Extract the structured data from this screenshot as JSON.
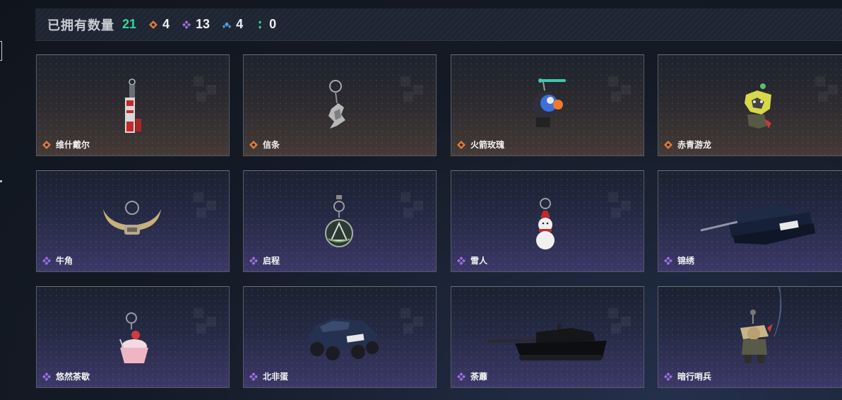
{
  "header": {
    "title": "已拥有数量",
    "total": "21",
    "stats": [
      {
        "icon": "orange-gem-icon",
        "value": "4",
        "color": "#e07a3a"
      },
      {
        "icon": "purple-gem-icon",
        "value": "13",
        "color": "#a06ee0"
      },
      {
        "icon": "blue-gem-icon",
        "value": "4",
        "color": "#4f9fe8"
      },
      {
        "icon": "green-gem-icon",
        "value": "0",
        "color": "#35d49a"
      }
    ]
  },
  "items": [
    {
      "name": "维什戴尔",
      "rarity": "orange",
      "icon": "banner-charm-icon"
    },
    {
      "name": "信条",
      "rarity": "orange",
      "icon": "eagle-charm-icon"
    },
    {
      "name": "火箭玫瑰",
      "rarity": "orange",
      "icon": "rocket-charm-icon"
    },
    {
      "name": "赤青游龙",
      "rarity": "orange",
      "icon": "dragon-charm-icon"
    },
    {
      "name": "牛角",
      "rarity": "purple",
      "icon": "horn-charm-icon"
    },
    {
      "name": "启程",
      "rarity": "purple",
      "icon": "medal-charm-icon"
    },
    {
      "name": "雪人",
      "rarity": "purple",
      "icon": "snowman-charm-icon"
    },
    {
      "name": "锦绣",
      "rarity": "purple",
      "icon": "tank-charm-icon"
    },
    {
      "name": "悠然茶歇",
      "rarity": "purple",
      "icon": "cupcake-charm-icon"
    },
    {
      "name": "北非蛋",
      "rarity": "purple",
      "icon": "armored-car-icon"
    },
    {
      "name": "荼蘼",
      "rarity": "purple",
      "icon": "black-tank-icon"
    },
    {
      "name": "暗行哨兵",
      "rarity": "purple",
      "icon": "soldier-charm-icon"
    }
  ],
  "rarity_colors": {
    "orange": "#e07a3a",
    "purple": "#a06ee0"
  }
}
